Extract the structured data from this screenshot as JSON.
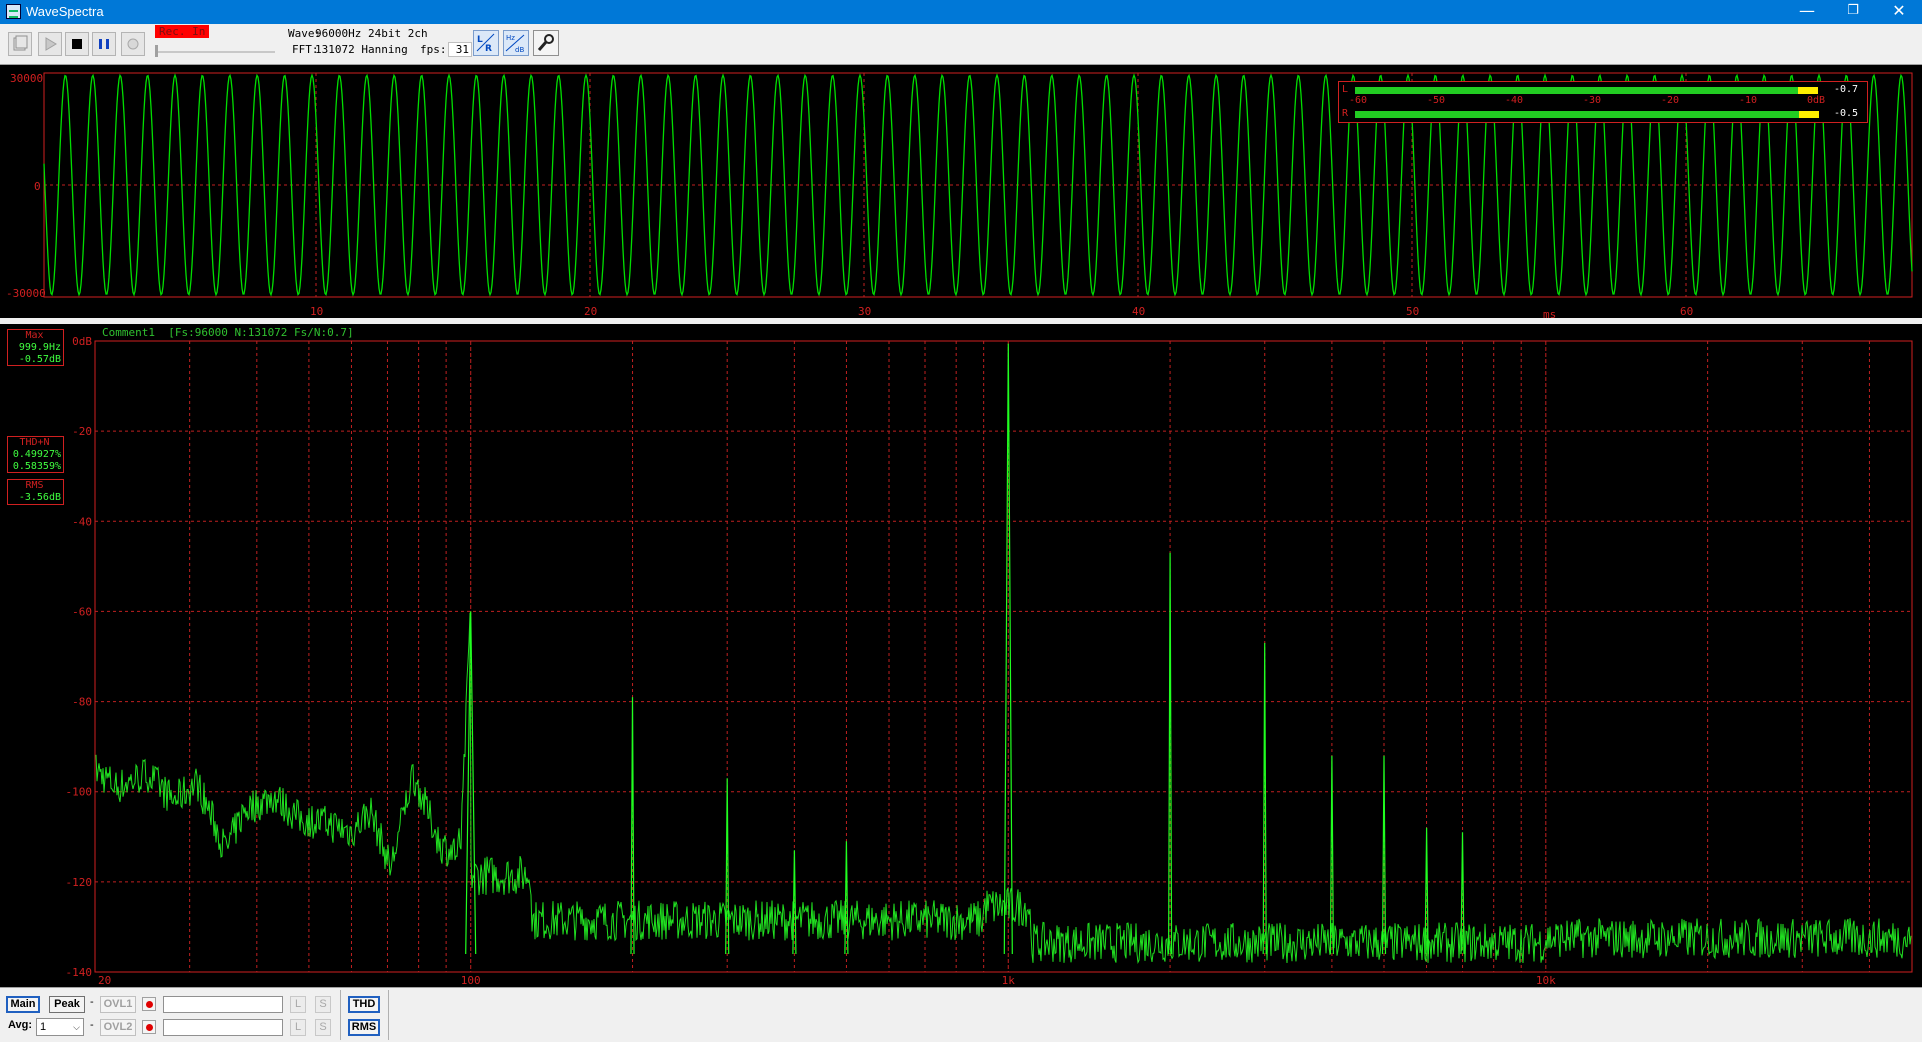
{
  "window": {
    "title": "WaveSpectra",
    "minimize": "—",
    "restore": "❐",
    "close": "✕"
  },
  "toolbar": {
    "rec_label": "Rec. In",
    "wave_label": "Wave:",
    "wave_value": "96000Hz 24bit 2ch",
    "fft_label": "FFT:",
    "fft_value": "131072 Hanning",
    "fps_label": "fps:",
    "fps_value": "31",
    "lr_button": "LR",
    "hz_db_button": "Hz dB",
    "settings_icon": "wrench-icon"
  },
  "waveform": {
    "y_ticks": [
      "30000",
      "0",
      "-30000"
    ],
    "x_ticks": [
      "10",
      "20",
      "30",
      "40",
      "50",
      "60"
    ],
    "x_unit": "ms",
    "signal_frequency_hz": 1000,
    "amplitude": 30000,
    "duration_ms": 68,
    "colors": {
      "trace": "#00dd00",
      "grid": "#c02020",
      "frame": "#d02020"
    }
  },
  "meter": {
    "left_label": "L",
    "right_label": "R",
    "scale": [
      "-60",
      "-50",
      "-40",
      "-30",
      "-20",
      "-10",
      "0dB"
    ],
    "left_value": "-0.7",
    "right_value": "-0.5",
    "left_level_db": -0.7,
    "right_level_db": -0.5
  },
  "spectrum": {
    "comment": "Comment1  [Fs:96000 N:131072 Fs/N:0.7]",
    "max_box": {
      "caption": "Max",
      "freq": "999.9Hz",
      "level": "-0.57dB"
    },
    "thd_box": {
      "caption": "THD+N",
      "v1": "0.49927%",
      "v2": "0.58359%"
    },
    "rms_box": {
      "caption": "RMS",
      "value": "-3.56dB"
    },
    "y_ticks": [
      "0dB",
      "-20",
      "-40",
      "-60",
      "-80",
      "-100",
      "-120",
      "-140"
    ],
    "x_ticks": [
      "20",
      "100",
      "1k",
      "10k"
    ]
  },
  "chart_data": {
    "type": "line",
    "title": "",
    "xlabel": "",
    "ylabel": "",
    "x_scale": "log",
    "xlim": [
      20,
      48000
    ],
    "ylim": [
      -140,
      0
    ],
    "series": [
      {
        "points": [
          [
            20,
            -95
          ],
          [
            22,
            -99
          ],
          [
            25,
            -96
          ],
          [
            28,
            -102
          ],
          [
            31,
            -98
          ],
          [
            35,
            -113
          ],
          [
            38,
            -104
          ],
          [
            43,
            -101
          ],
          [
            48,
            -106
          ],
          [
            54,
            -107
          ],
          [
            60,
            -109
          ],
          [
            65,
            -104
          ],
          [
            71,
            -117
          ],
          [
            78,
            -96
          ],
          [
            88,
            -112
          ],
          [
            96,
            -114
          ],
          [
            100,
            -60
          ],
          [
            105,
            -112
          ],
          [
            125,
            -120
          ],
          [
            150,
            -129
          ],
          [
            200,
            -79
          ],
          [
            220,
            -132
          ],
          [
            300,
            -97
          ],
          [
            330,
            -133
          ],
          [
            400,
            -113
          ],
          [
            500,
            -111
          ],
          [
            800,
            -136
          ],
          [
            900,
            -131
          ],
          [
            1000,
            -0.57
          ],
          [
            1100,
            -134
          ],
          [
            1500,
            -134
          ],
          [
            2000,
            -47
          ],
          [
            2100,
            -134
          ],
          [
            3000,
            -67
          ],
          [
            3200,
            -136
          ],
          [
            4000,
            -92
          ],
          [
            5000,
            -92
          ],
          [
            6000,
            -108
          ],
          [
            7000,
            -109
          ],
          [
            10000,
            -137
          ],
          [
            20000,
            -138
          ],
          [
            48000,
            -137
          ]
        ],
        "harmonic_peaks": [
          [
            100,
            -60
          ],
          [
            200,
            -79
          ],
          [
            300,
            -97
          ],
          [
            400,
            -113
          ],
          [
            500,
            -111
          ],
          [
            1000,
            -0.57
          ],
          [
            2000,
            -47
          ],
          [
            3000,
            -67
          ],
          [
            4000,
            -92
          ],
          [
            5000,
            -92
          ],
          [
            6000,
            -108
          ],
          [
            7000,
            -109
          ]
        ]
      }
    ],
    "grid": true
  },
  "bottombar": {
    "main": "Main",
    "peak": "Peak",
    "dash1": "-",
    "dash2": "-",
    "ovl1": "OVL1",
    "ovl2": "OVL2",
    "l": "L",
    "s": "S",
    "thd": "THD",
    "rms": "RMS",
    "avg_label": "Avg:",
    "avg_value": "1"
  }
}
